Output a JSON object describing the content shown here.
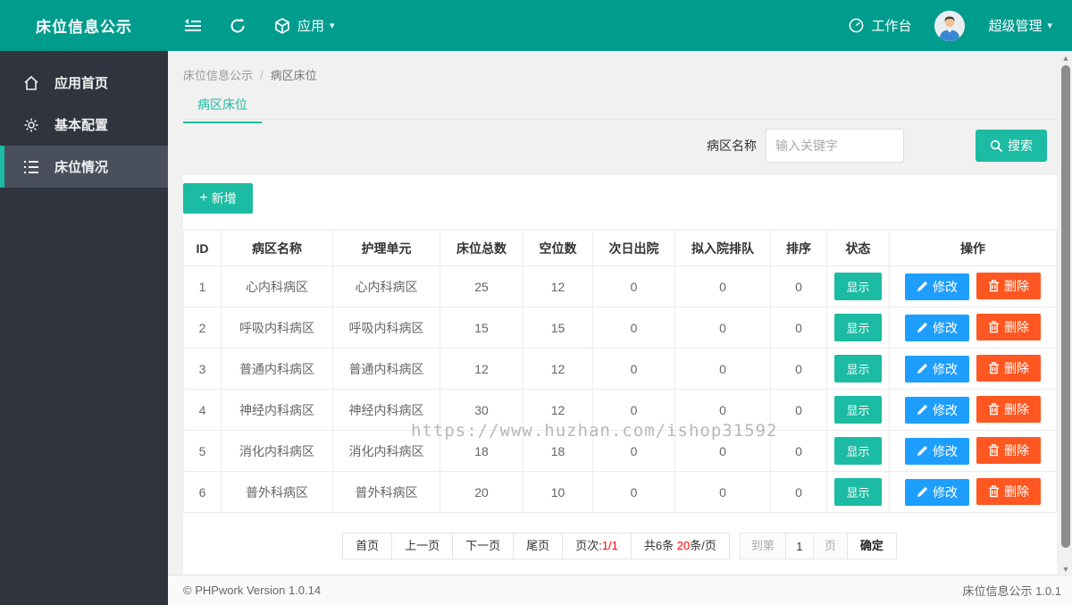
{
  "topbar": {
    "title": "床位信息公示",
    "app_menu_label": "应用",
    "workbench_label": "工作台",
    "user_label": "超级管理"
  },
  "sidebar": {
    "items": [
      {
        "label": "应用首页",
        "icon": "home-icon",
        "active": false
      },
      {
        "label": "基本配置",
        "icon": "gear-icon",
        "active": false
      },
      {
        "label": "床位情况",
        "icon": "list-icon",
        "active": true
      }
    ]
  },
  "breadcrumb": {
    "root": "床位信息公示",
    "separator": "/",
    "current": "病区床位"
  },
  "tab": {
    "label": "病区床位"
  },
  "search": {
    "label": "病区名称",
    "placeholder": "输入关键字",
    "button_label": "搜索"
  },
  "toolbar": {
    "add_label": "新增",
    "add_plus": "+"
  },
  "table": {
    "headers": [
      "ID",
      "病区名称",
      "护理单元",
      "床位总数",
      "空位数",
      "次日出院",
      "拟入院排队",
      "排序",
      "状态",
      "操作"
    ],
    "action_edit": "修改",
    "action_delete": "删除",
    "rows": [
      {
        "id": "1",
        "ward": "心内科病区",
        "unit": "心内科病区",
        "total": "25",
        "empty": "12",
        "discharge": "0",
        "queue": "0",
        "sort": "0",
        "status": "显示"
      },
      {
        "id": "2",
        "ward": "呼吸内科病区",
        "unit": "呼吸内科病区",
        "total": "15",
        "empty": "15",
        "discharge": "0",
        "queue": "0",
        "sort": "0",
        "status": "显示"
      },
      {
        "id": "3",
        "ward": "普通内科病区",
        "unit": "普通内科病区",
        "total": "12",
        "empty": "12",
        "discharge": "0",
        "queue": "0",
        "sort": "0",
        "status": "显示"
      },
      {
        "id": "4",
        "ward": "神经内科病区",
        "unit": "神经内科病区",
        "total": "30",
        "empty": "12",
        "discharge": "0",
        "queue": "0",
        "sort": "0",
        "status": "显示"
      },
      {
        "id": "5",
        "ward": "消化内科病区",
        "unit": "消化内科病区",
        "total": "18",
        "empty": "18",
        "discharge": "0",
        "queue": "0",
        "sort": "0",
        "status": "显示"
      },
      {
        "id": "6",
        "ward": "普外科病区",
        "unit": "普外科病区",
        "total": "20",
        "empty": "10",
        "discharge": "0",
        "queue": "0",
        "sort": "0",
        "status": "显示"
      }
    ]
  },
  "watermark": "https://www.huzhan.com/ishop31592",
  "pagination": {
    "first": "首页",
    "prev": "上一页",
    "next": "下一页",
    "last": "尾页",
    "page_label": "页次:",
    "page_value": "1/1",
    "total_label": "共6条 ",
    "per_page_value": "20",
    "per_page_suffix": "条/页",
    "goto_label": "到第",
    "goto_value": "1",
    "goto_suffix": "页",
    "confirm": "确定"
  },
  "footer": {
    "left": "© PHPwork Version 1.0.14",
    "right": "床位信息公示 1.0.1"
  },
  "colors": {
    "topbar_teal": "#009c8d",
    "button_teal": "#1cbba3",
    "sidebar_dark": "#30343f",
    "sidebar_active": "#4a4f5c",
    "edit_blue": "#1e9fff",
    "delete_orange": "#ff5722",
    "pagination_red": "#ff0000"
  }
}
